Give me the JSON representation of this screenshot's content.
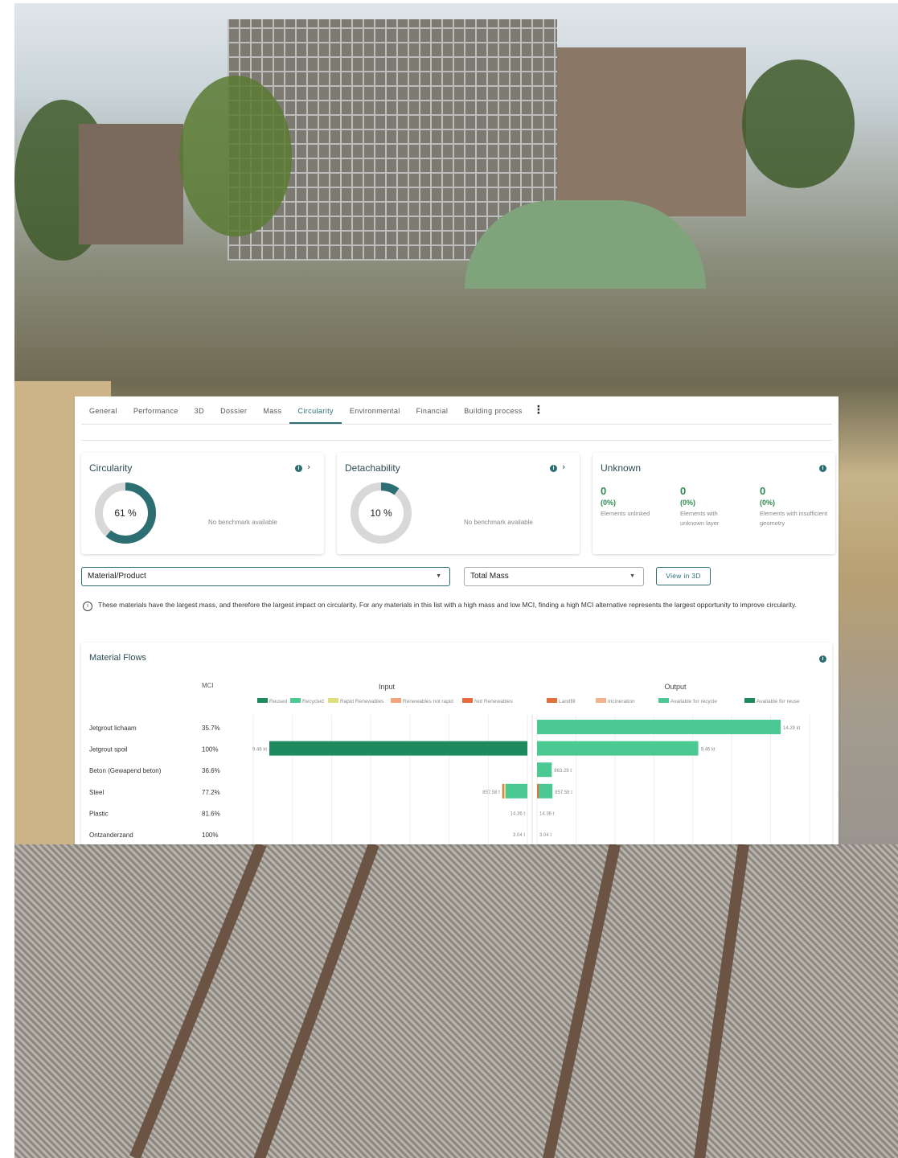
{
  "tabs": [
    {
      "label": "General",
      "active": false
    },
    {
      "label": "Performance",
      "active": false
    },
    {
      "label": "3D",
      "active": false
    },
    {
      "label": "Dossier",
      "active": false
    },
    {
      "label": "Mass",
      "active": false
    },
    {
      "label": "Circularity",
      "active": true
    },
    {
      "label": "Environmental",
      "active": false
    },
    {
      "label": "Financial",
      "active": false
    },
    {
      "label": "Building process",
      "active": false
    }
  ],
  "cards": {
    "circularity": {
      "title": "Circularity",
      "value_label": "61 %",
      "value": 61,
      "benchmark": "No benchmark available"
    },
    "detachability": {
      "title": "Detachability",
      "value_label": "10 %",
      "value": 10,
      "benchmark": "No benchmark available"
    },
    "unknown": {
      "title": "Unknown",
      "columns": [
        {
          "count": "0",
          "pct": "(0%)",
          "label": "Elements unlinked"
        },
        {
          "count": "0",
          "pct": "(0%)",
          "label": "Elements with unknown layer"
        },
        {
          "count": "0",
          "pct": "(0%)",
          "label": "Elements with insufficient geometry"
        }
      ]
    }
  },
  "controls": {
    "group_by": "Material/Product",
    "measure": "Total Mass",
    "view3d": "View in 3D"
  },
  "note": "These materials have the largest mass, and therefore the largest impact on circularity. For any materials in this list with a high mass and low MCI, finding a high MCI alternative represents the largest opportunity to improve circularity.",
  "flows": {
    "title": "Material Flows",
    "mci_header": "MCI",
    "input_header": "Input",
    "output_header": "Output"
  },
  "colors": {
    "accent": "#2c6e72",
    "reused": "#1f8a5e",
    "recycled": "#4cc993",
    "rapid_renewables": "#dde07a",
    "renewables_not_rapid": "#f0a57c",
    "not_renewables": "#e8693c",
    "landfill": "#e0703c",
    "incineration": "#f2b18f",
    "available_recycle": "#4cc993",
    "available_reuse": "#1f8a5e"
  },
  "chart_data": {
    "type": "bar",
    "input_legend": [
      "Reused",
      "Recycled",
      "Rapid Renewables",
      "Renewables not rapid",
      "Not Renewables"
    ],
    "output_legend": [
      "Landfill",
      "Incineration",
      "Available for recycle",
      "Available for reuse"
    ],
    "rows": [
      {
        "name": "Jetgrout lichaam",
        "mci": "35.7%",
        "input": [],
        "input_label": "",
        "output": [
          {
            "cat": "Available for recycle",
            "value": 14.29
          }
        ],
        "output_label": "14.29 kt"
      },
      {
        "name": "Jetgrout spoil",
        "mci": "100%",
        "input": [
          {
            "cat": "Reused",
            "value": 9.46
          }
        ],
        "input_label": "9.46 kt",
        "output": [
          {
            "cat": "Available for recycle",
            "value": 9.46
          }
        ],
        "output_label": "9.46 kt"
      },
      {
        "name": "Beton (Gewapend beton)",
        "mci": "36.6%",
        "input": [],
        "input_label": "",
        "output": [
          {
            "cat": "Available for recycle",
            "value": 0.863
          }
        ],
        "output_label": "863.29 t"
      },
      {
        "name": "Steel",
        "mci": "77.2%",
        "input": [
          {
            "cat": "Recycled",
            "value": 0.8
          },
          {
            "cat": "Rapid Renewables",
            "value": 0.04
          },
          {
            "cat": "Not Renewables",
            "value": 0.02
          }
        ],
        "input_label": "857.58 t",
        "output": [
          {
            "cat": "Landfill",
            "value": 0.05
          },
          {
            "cat": "Available for recycle",
            "value": 0.81
          }
        ],
        "output_label": "857.58 t"
      },
      {
        "name": "Plastic",
        "mci": "81.6%",
        "input": [],
        "input_label": "14.36 t",
        "output": [],
        "output_label": "14.36 t"
      },
      {
        "name": "Ontzanderzand",
        "mci": "100%",
        "input": [],
        "input_label": "3.04 t",
        "output": [],
        "output_label": "3.04 t"
      }
    ],
    "input_max": 9.46,
    "output_max": 14.29,
    "unit": "kt"
  }
}
